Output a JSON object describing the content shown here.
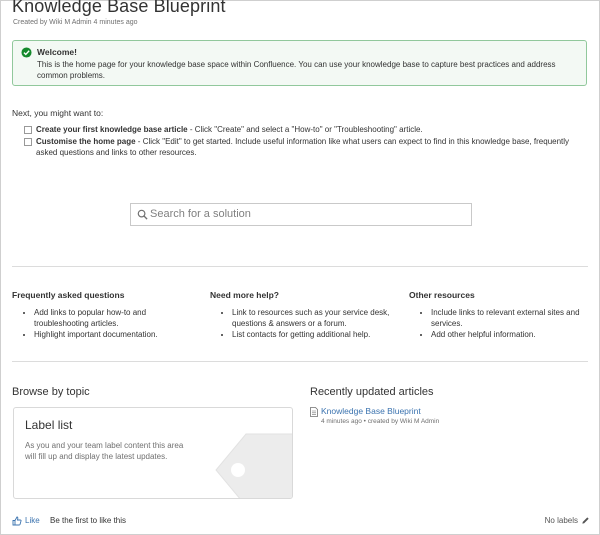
{
  "page": {
    "title": "Knowledge Base Blueprint",
    "byline": "Created by Wiki M Admin 4 minutes ago"
  },
  "welcome": {
    "icon": "check-circle-icon",
    "title": "Welcome!",
    "text": "This is the home page for your knowledge base space within Confluence. You can use your knowledge base to capture best practices and address common problems."
  },
  "next": {
    "label": "Next, you might want to:",
    "tasks": [
      {
        "bold": "Create your first knowledge base article",
        "text": " - Click \"Create\" and select a \"How-to\" or \"Troubleshooting\" article."
      },
      {
        "bold": "Customise the home page",
        "text": " - Click \"Edit\" to get started. Include useful information like what users can expect to find in this knowledge base, frequently asked questions and links to other resources."
      }
    ]
  },
  "search": {
    "placeholder": "Search for a solution",
    "icon": "search-icon"
  },
  "columns": [
    {
      "heading": "Frequently asked questions",
      "items": [
        "Add links to popular how-to and troubleshooting articles.",
        "Highlight important documentation."
      ]
    },
    {
      "heading": "Need more help?",
      "items": [
        "Link to resources such as your service desk, questions & answers or a forum.",
        "List contacts for getting additional help."
      ]
    },
    {
      "heading": "Other resources",
      "items": [
        "Include links to relevant external sites and services.",
        "Add other helpful information."
      ]
    }
  ],
  "browse": {
    "title": "Browse by topic",
    "card_title": "Label list",
    "card_text": "As you and your team label content this area will fill up and display the latest updates."
  },
  "recent": {
    "title": "Recently updated articles",
    "items": [
      {
        "title": "Knowledge Base Blueprint",
        "meta": "4 minutes ago • created by Wiki M Admin"
      }
    ]
  },
  "footer": {
    "like": "Like",
    "first_to_like": "Be the first to like this",
    "no_labels": "No labels"
  },
  "colors": {
    "link": "#3b73af",
    "success_border": "#91c89c",
    "success_bg": "#f3f9f4",
    "success_icon": "#14892c"
  }
}
